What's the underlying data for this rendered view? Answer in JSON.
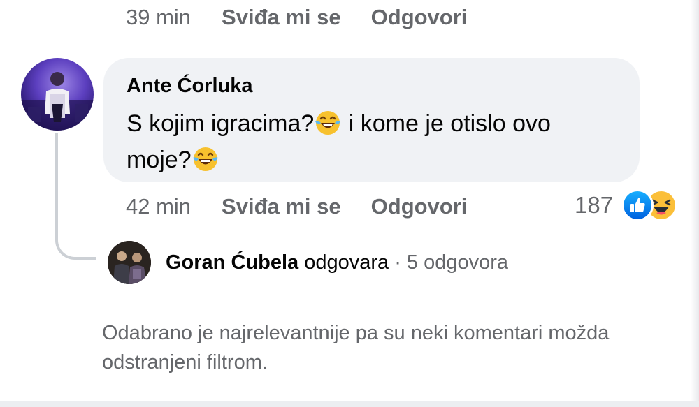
{
  "previous_comment": {
    "time": "39 min",
    "like_label": "Sviđa mi se",
    "reply_label": "Odgovori"
  },
  "comment": {
    "author": "Ante Ćorluka",
    "text_line1": "S kojim igracima?",
    "text_mid": " i kome je otislo ovo",
    "text_line2": "moje?",
    "emoji": "grinning-with-tears-emoji",
    "time": "42 min",
    "like_label": "Sviđa mi se",
    "reply_label": "Odgovori",
    "reaction_count": "187",
    "reactions": [
      "like-icon",
      "haha-icon"
    ],
    "colors": {
      "bubble": "#f0f2f5",
      "like_blue": "#1877f2",
      "meta_gray": "#65676b"
    }
  },
  "replies": {
    "author": "Goran Ćubela",
    "verb": " odgovara",
    "count_text": " · 5 odgovora"
  },
  "filter_note": "Odabrano je najrelevantnije pa su neki komentari možda odstranjeni filtrom."
}
